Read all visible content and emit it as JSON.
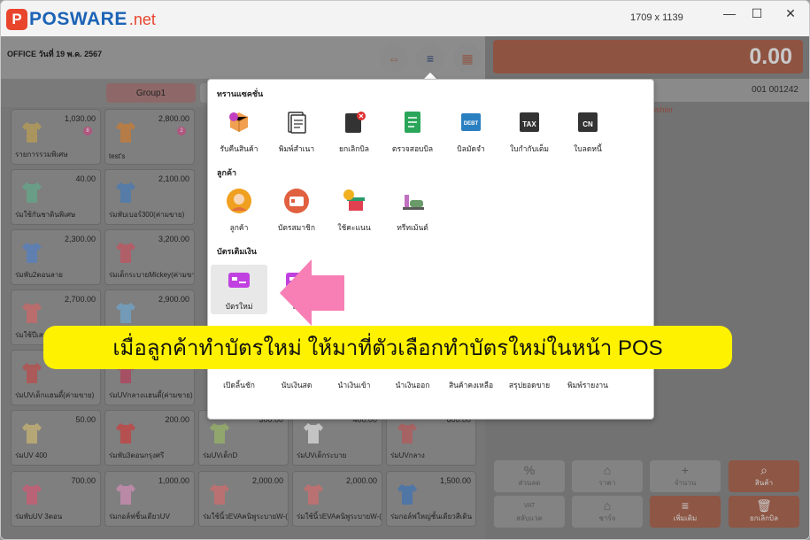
{
  "window": {
    "brand": "POSWARE",
    "brand_suffix": ".net",
    "resolution": "1709 x 1139",
    "controls": {
      "minimize": "—",
      "maximize": "☐",
      "close": "✕"
    }
  },
  "header": {
    "office_date": "OFFICE วันที่ 19 พ.ค. 2567"
  },
  "groups": {
    "active_label": "Group1"
  },
  "products": [
    {
      "price": "1,030.00",
      "name": "รายการรวมพิเศษ",
      "badge": "8",
      "color": "#c8a34a"
    },
    {
      "price": "2,800.00",
      "name": "test's",
      "badge": "2",
      "color": "#d87a22"
    },
    {
      "price": "40.00",
      "name": "ร่มใช้กันชาดินพิเศษ",
      "color": "#5bb08a"
    },
    {
      "price": "2,100.00",
      "name": "ร่มพับเบอร์300(ค่ามขาย)",
      "color": "#3b78c0"
    },
    {
      "price": "2,300.00",
      "name": "ร่มพับ2ตอนลาย",
      "color": "#4a7fd0"
    },
    {
      "price": "3,200.00",
      "name": "ร่มเด็กระบายMickey(ค่ามขาย)",
      "color": "#d04a5a"
    },
    {
      "price": "2,700.00",
      "name": "ร่มใช้ปีเสา",
      "color": "#e06060"
    },
    {
      "price": "2,900.00",
      "name": "ร่มUVเด็ก",
      "color": "#6aaedc"
    },
    {
      "price": "",
      "name": "ร่มUVเด็กแฮนดี้(ค่ามขาย)",
      "color": "#c84040"
    },
    {
      "price": "",
      "name": "ร่มUVกลางแฮนดี้(ค่ามขาย)",
      "color": "#c03050"
    },
    {
      "price": "50.00",
      "name": "ร่มUV 400",
      "color": "#d8c070"
    },
    {
      "price": "200.00",
      "name": "ร่มพับ3ตอนกรุงศรี",
      "color": "#d83030"
    },
    {
      "price": "300.00",
      "name": "ร่มUVเด็กD",
      "color": "#9cc060"
    },
    {
      "price": "400.00",
      "name": "ร่มUVเด็กระบาย",
      "color": "#f0f0f0"
    },
    {
      "price": "600.00",
      "name": "ร่มUVกลาง",
      "color": "#c05050"
    },
    {
      "price": "700.00",
      "name": "ร่มพับUV 3ตอน",
      "color": "#e05070"
    },
    {
      "price": "1,000.00",
      "name": "ร่มกอล์ฟชิ้นเดียวUV",
      "color": "#e090c0"
    },
    {
      "price": "2,000.00",
      "name": "ร่มใช้นิ้วEVAคนิพูระบายW-(",
      "color": "#e06868"
    },
    {
      "price": "2,000.00",
      "name": "ร่มใช้นิ้วEVAคนิพูระบายW-(",
      "color": "#e06868"
    },
    {
      "price": "1,500.00",
      "name": "ร่มกอล์ฟใหญ่ชั้นเดียวสีเดิน",
      "color": "#3070c0"
    }
  ],
  "right": {
    "total": "0.00",
    "bill_no": "001 001242",
    "cashier": "ashier"
  },
  "actions": [
    {
      "icon": "%",
      "label": "ส่วนลด",
      "orange": false
    },
    {
      "icon": "⌂",
      "label": "ราคา",
      "orange": false
    },
    {
      "icon": "+",
      "label": "จำนวน",
      "orange": false
    },
    {
      "icon": "⌕",
      "label": "สินค้า",
      "orange": true
    },
    {
      "icon": "VAT",
      "label": "สลับแวต",
      "orange": false
    },
    {
      "icon": "⌂",
      "label": "ชาร์จ",
      "orange": false
    },
    {
      "icon": "≡",
      "label": "เพิ่มเติม",
      "orange": true
    },
    {
      "icon": "🗑",
      "label": "ยกเลิกบิล",
      "orange": true
    }
  ],
  "popup": {
    "sections": [
      {
        "title": "ทรานแซคชั่น",
        "items": [
          {
            "label": "รับคืนสินค้า",
            "icon": "return-goods-icon",
            "color": "#f0a050"
          },
          {
            "label": "พิมพ์สำเนา",
            "icon": "print-copy-icon",
            "color": "#333333"
          },
          {
            "label": "ยกเลิกบิล",
            "icon": "cancel-bill-icon",
            "color": "#333333"
          },
          {
            "label": "ตรวจสอบบิล",
            "icon": "check-bill-icon",
            "color": "#2aa55a"
          },
          {
            "label": "บิลมัดจำ",
            "icon": "deposit-bill-icon",
            "color": "#2a7fc0"
          },
          {
            "label": "ใบกำกับเต็ม",
            "icon": "tax-invoice-icon",
            "color": "#333333"
          },
          {
            "label": "ใบลดหนี้",
            "icon": "credit-note-icon",
            "color": "#333333"
          }
        ]
      },
      {
        "title": "ลูกค้า",
        "items": [
          {
            "label": "ลูกค้า",
            "icon": "customer-icon",
            "color": "#f0a020"
          },
          {
            "label": "บัตรสมาชิก",
            "icon": "member-card-icon",
            "color": "#e06040"
          },
          {
            "label": "ใช้คะแนน",
            "icon": "use-points-icon",
            "color": "#f0b020"
          },
          {
            "label": "ทรีทเม้นต์",
            "icon": "treatment-icon",
            "color": "#6a9a6a"
          }
        ]
      },
      {
        "title": "บัตรเติมเงิน",
        "items": [
          {
            "label": "บัตรใหม่",
            "icon": "new-card-icon",
            "color": "#c040e0",
            "selected": true
          },
          {
            "label": "เติ",
            "icon": "topup-icon",
            "color": "#c040e0"
          }
        ]
      },
      {
        "title": "",
        "items": [
          {
            "label": "เปิดลิ้นชัก",
            "icon": "open-drawer-icon",
            "color": "#f0b020"
          },
          {
            "label": "นับเงินสด",
            "icon": "count-cash-icon",
            "color": "#f0b020"
          },
          {
            "label": "นำเงินเข้า",
            "icon": "cash-in-icon",
            "color": "#f0b020"
          },
          {
            "label": "นำเงินออก",
            "icon": "cash-out-icon",
            "color": "#f0b020"
          },
          {
            "label": "สินค้าคงเหลือ",
            "icon": "stock-icon",
            "color": "#2a9a9a"
          },
          {
            "label": "สรุปยอดขาย",
            "icon": "sales-summary-icon",
            "color": "#2a9a9a"
          },
          {
            "label": "พิมพ์รายงาน",
            "icon": "print-report-icon",
            "color": "#555555"
          }
        ]
      }
    ]
  },
  "annotation": {
    "text": "เมื่อลูกค้าทำบัตรใหม่ ให้มาที่ตัวเลือกทำบัตรใหม่ในหน้า POS",
    "arrow_color": "#f77fb5",
    "banner_color": "#fff200"
  }
}
